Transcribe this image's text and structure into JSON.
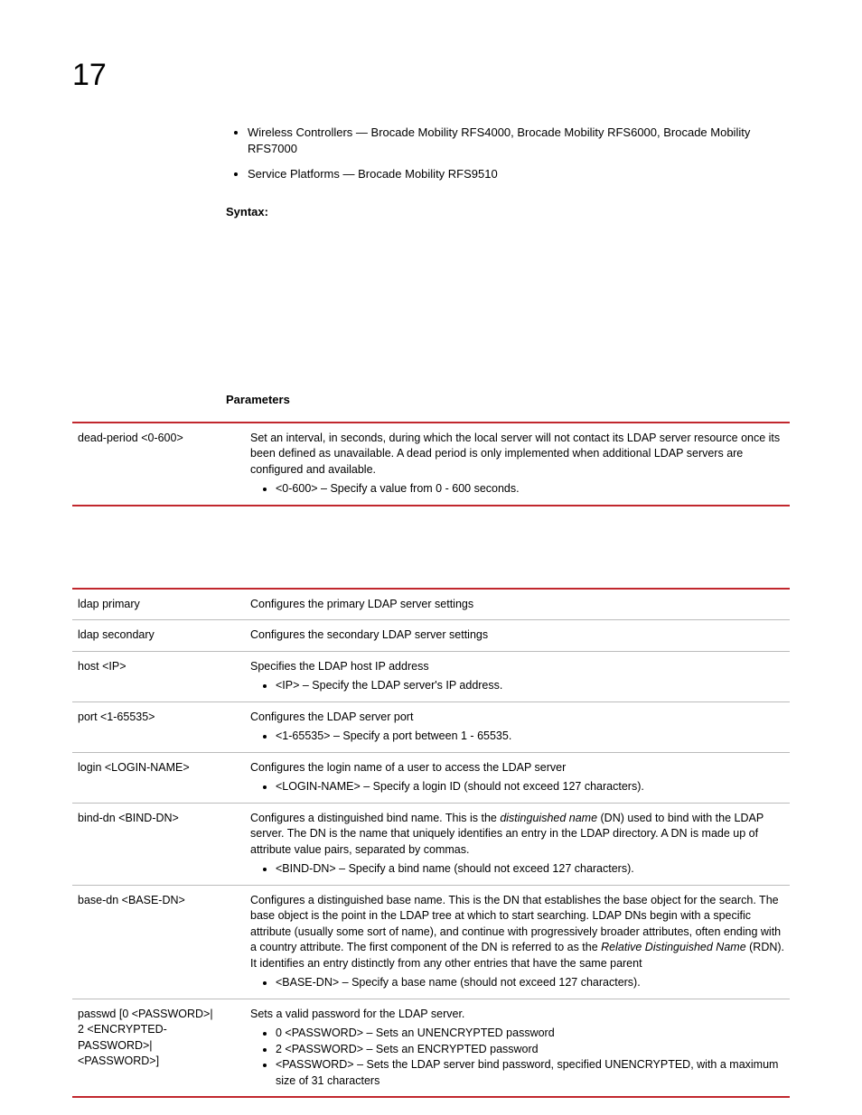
{
  "chapter": "17",
  "top_bullets": [
    "Wireless Controllers — Brocade Mobility RFS4000, Brocade Mobility RFS6000, Brocade Mobility RFS7000",
    "Service Platforms — Brocade Mobility RFS9510"
  ],
  "syntax_label": "Syntax:",
  "parameters_label": "Parameters",
  "table1": {
    "row": {
      "param": "dead-period <0-600>",
      "desc": "Set an interval, in seconds, during which the local server will not contact its LDAP server resource once its been defined as unavailable. A dead period is only implemented when additional LDAP servers are configured and available.",
      "bullet": "<0-600> – Specify a value from 0 - 600 seconds."
    }
  },
  "table2": {
    "rows": [
      {
        "param": "ldap primary",
        "desc": "Configures the primary LDAP server settings",
        "bullets": []
      },
      {
        "param": "ldap secondary",
        "desc": "Configures the secondary LDAP server settings",
        "bullets": []
      },
      {
        "param": "host <IP>",
        "desc": "Specifies the LDAP host IP address",
        "bullets": [
          "<IP> – Specify the LDAP server's IP address."
        ]
      },
      {
        "param": "port <1-65535>",
        "desc": "Configures the LDAP server port",
        "bullets": [
          "<1-65535> – Specify a port between 1 - 65535."
        ]
      },
      {
        "param": "login <LOGIN-NAME>",
        "desc": "Configures the login name of a user to access the LDAP server",
        "bullets": [
          "<LOGIN-NAME> – Specify a login ID (should not exceed 127 characters)."
        ]
      },
      {
        "param": "bind-dn <BIND-DN>",
        "desc_parts": [
          "Configures a distinguished bind name. This is the ",
          "distinguished name",
          " (DN) used to bind with the LDAP server. The DN is the name that uniquely identifies an entry in the LDAP directory. A DN is made up of attribute value pairs, separated by commas."
        ],
        "bullets": [
          "<BIND-DN> – Specify a bind name (should not exceed 127 characters)."
        ]
      },
      {
        "param": "base-dn <BASE-DN>",
        "desc_parts": [
          "Configures a distinguished base name. This is the DN that establishes the base object for the search. The base object is the point in the LDAP tree at which to start searching. LDAP DNs begin with a specific attribute (usually some sort of name), and continue with progressively broader attributes, often ending with a country attribute. The first component of the DN is referred to as the ",
          "Relative Distinguished Name",
          " (RDN). It identifies an entry distinctly from any other entries that have the same parent"
        ],
        "bullets": [
          "<BASE-DN> – Specify a base name (should not exceed 127 characters)."
        ]
      },
      {
        "param": "passwd [0 <PASSWORD>|\n2 <ENCRYPTED-PASSWORD>|\n<PASSWORD>]",
        "desc": "Sets a valid password for the LDAP server.",
        "bullets": [
          "0 <PASSWORD> – Sets an UNENCRYPTED password",
          "2 <PASSWORD> – Sets an ENCRYPTED password",
          "<PASSWORD> – Sets the LDAP server bind password, specified UNENCRYPTED, with a maximum size of 31 characters"
        ]
      }
    ]
  }
}
